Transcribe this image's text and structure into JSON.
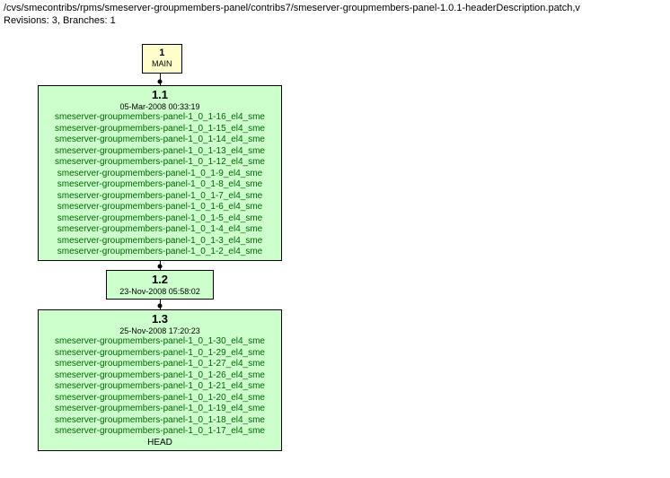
{
  "header": {
    "path": "/cvs/smecontribs/rpms/smeserver-groupmembers-panel/contribs7/smeserver-groupmembers-panel-1.0.1-headerDescription.patch,v",
    "info": "Revisions: 3, Branches: 1"
  },
  "branch": {
    "number": "1",
    "name": "MAIN"
  },
  "revisions": [
    {
      "id": "1.1",
      "date": "05-Mar-2008 00:33:19",
      "tags": [
        "smeserver-groupmembers-panel-1_0_1-16_el4_sme",
        "smeserver-groupmembers-panel-1_0_1-15_el4_sme",
        "smeserver-groupmembers-panel-1_0_1-14_el4_sme",
        "smeserver-groupmembers-panel-1_0_1-13_el4_sme",
        "smeserver-groupmembers-panel-1_0_1-12_el4_sme",
        "smeserver-groupmembers-panel-1_0_1-9_el4_sme",
        "smeserver-groupmembers-panel-1_0_1-8_el4_sme",
        "smeserver-groupmembers-panel-1_0_1-7_el4_sme",
        "smeserver-groupmembers-panel-1_0_1-6_el4_sme",
        "smeserver-groupmembers-panel-1_0_1-5_el4_sme",
        "smeserver-groupmembers-panel-1_0_1-4_el4_sme",
        "smeserver-groupmembers-panel-1_0_1-3_el4_sme",
        "smeserver-groupmembers-panel-1_0_1-2_el4_sme"
      ],
      "head": ""
    },
    {
      "id": "1.2",
      "date": "23-Nov-2008 05:58:02",
      "tags": [],
      "head": ""
    },
    {
      "id": "1.3",
      "date": "25-Nov-2008 17:20:23",
      "tags": [
        "smeserver-groupmembers-panel-1_0_1-30_el4_sme",
        "smeserver-groupmembers-panel-1_0_1-29_el4_sme",
        "smeserver-groupmembers-panel-1_0_1-27_el4_sme",
        "smeserver-groupmembers-panel-1_0_1-26_el4_sme",
        "smeserver-groupmembers-panel-1_0_1-21_el4_sme",
        "smeserver-groupmembers-panel-1_0_1-20_el4_sme",
        "smeserver-groupmembers-panel-1_0_1-19_el4_sme",
        "smeserver-groupmembers-panel-1_0_1-18_el4_sme",
        "smeserver-groupmembers-panel-1_0_1-17_el4_sme"
      ],
      "head": "HEAD"
    }
  ]
}
